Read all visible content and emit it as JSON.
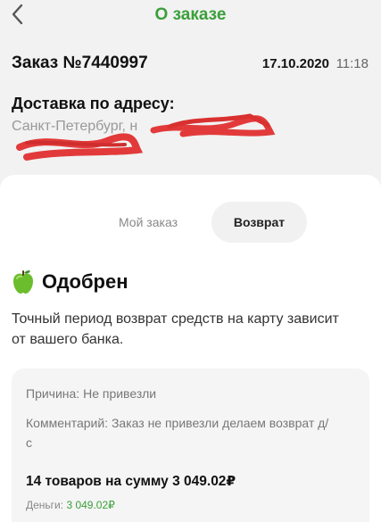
{
  "header": {
    "title": "О заказе",
    "back_icon": "chevron-left-icon"
  },
  "order": {
    "number": "Заказ №7440997",
    "date": "17.10.2020",
    "time": "11:18",
    "address_label": "Доставка по адресу:",
    "address_text": "Санкт-Петербург, н"
  },
  "tabs": [
    {
      "label": "Мой заказ",
      "active": false
    },
    {
      "label": "Возврат",
      "active": true
    }
  ],
  "status": {
    "icon": "green-apple-icon",
    "label": "Одобрен",
    "note": "Точный период возврат средств на карту зависит от вашего банка."
  },
  "details": {
    "reason": "Причина: Не привезли",
    "comment": "Комментарий: Заказ не привезли делаем возврат д/ с",
    "total": "14 товаров на сумму 3 049.02₽",
    "money_label": "Деньги:",
    "money_value": "3 049.02₽"
  },
  "colors": {
    "accent": "#3a9f3a",
    "redaction": "#e23a3a"
  }
}
